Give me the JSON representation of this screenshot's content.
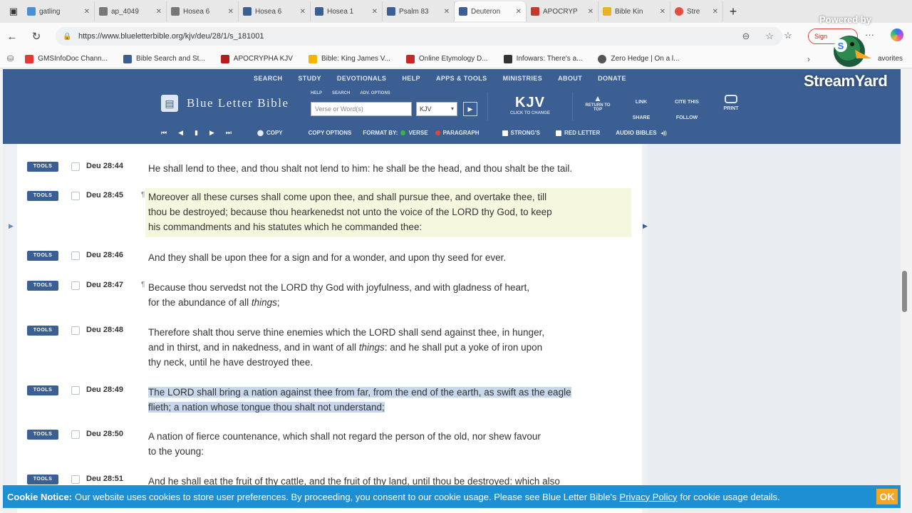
{
  "browser": {
    "tabs": [
      {
        "label": "gatling",
        "fav_color": "#4a90d9"
      },
      {
        "label": "ap_4049",
        "fav_color": "#777777"
      },
      {
        "label": "Hosea 6",
        "fav_color": "#777777"
      },
      {
        "label": "Hosea 6",
        "fav_color": "#3b5f92"
      },
      {
        "label": "Hosea 1",
        "fav_color": "#3b5f92"
      },
      {
        "label": "Psalm 83",
        "fav_color": "#3b5f92"
      },
      {
        "label": "Deuteron",
        "fav_color": "#3b5f92"
      },
      {
        "label": "APOCRYP",
        "fav_color": "#c0392b"
      },
      {
        "label": "Bible Kin",
        "fav_color": "#e6b422"
      },
      {
        "label": "Stre",
        "fav_color": "#e74c3c"
      }
    ],
    "url": "https://www.blueletterbible.org/kjv/deu/28/1/s_181001",
    "signin_label": "Sign",
    "bookmarks": [
      {
        "label": "GMSInfoDoc Chann...",
        "color": "#e53935"
      },
      {
        "label": "Bible Search and St...",
        "color": "#3b5f92"
      },
      {
        "label": "APOCRYPHA KJV",
        "color": "#b71c1c"
      },
      {
        "label": "Bible: King James V...",
        "color": "#f4b400"
      },
      {
        "label": "Online Etymology D...",
        "color": "#c62828"
      },
      {
        "label": "Infowars: There's a...",
        "color": "#333333"
      },
      {
        "label": "Zero Hedge | On a l...",
        "color": "#555555"
      }
    ],
    "favorites_label": "avorites"
  },
  "overlay": {
    "powered_by": "Powered by",
    "brand": "StreamYard"
  },
  "site": {
    "topnav": [
      "SEARCH",
      "STUDY",
      "DEVOTIONALS",
      "HELP",
      "APPS & TOOLS",
      "MINISTRIES",
      "ABOUT",
      "DONATE"
    ],
    "brand_name": "Blue Letter Bible",
    "small_links": [
      "HELP",
      "SEARCH",
      "ADV. OPTIONS"
    ],
    "search_placeholder": "Verse or Word(s)",
    "version": "KJV",
    "kjv_big": "KJV",
    "kjv_sub": "CLICK TO CHANGE",
    "return_top": "RETURN TO TOP",
    "link": "LINK",
    "share": "SHARE",
    "cite": "CITE THIS",
    "follow": "FOLLOW",
    "print": "PRINT",
    "copy": "COPY",
    "copy_options": "COPY OPTIONS",
    "format_by": "FORMAT BY:",
    "verse": "VERSE",
    "paragraph": "PARAGRAPH",
    "strongs": "STRONG'S",
    "red_letter": "RED LETTER",
    "audio": "AUDIO BIBLES"
  },
  "verses": [
    {
      "tools": "TOOLS",
      "ref": "Deu 28:44",
      "para": "",
      "lines": [
        "He shall lend to thee, and thou shalt not lend to him: he shall be the head, and thou shalt be the tail."
      ]
    },
    {
      "tools": "TOOLS",
      "ref": "Deu 28:45",
      "para": "¶",
      "lines": [
        "Moreover all these curses shall come upon thee, and shall pursue thee, and overtake thee, till",
        "thou be destroyed; because thou hearkenedst not unto the voice of the LORD thy God, to keep",
        "his commandments and his statutes which he commanded thee:"
      ]
    },
    {
      "tools": "TOOLS",
      "ref": "Deu 28:46",
      "para": "",
      "lines": [
        "And they shall be upon thee for a sign and for a wonder, and upon thy seed for ever."
      ]
    },
    {
      "tools": "TOOLS",
      "ref": "Deu 28:47",
      "para": "¶",
      "line1": "Because thou servedst not the LORD thy God with joyfulness, and with gladness of heart,",
      "line2_pre": "for the abundance of all ",
      "line2_ital": "things",
      "line2_post": ";"
    },
    {
      "tools": "TOOLS",
      "ref": "Deu 28:48",
      "para": "",
      "line1": "Therefore shalt thou serve thine enemies which the LORD shall send against thee, in hunger,",
      "line2_pre": "and in thirst, and in nakedness, and in want of all ",
      "line2_ital": "things",
      "line2_post": ": and he shall put a yoke of iron upon",
      "line3": "thy neck, until he have destroyed thee."
    },
    {
      "tools": "TOOLS",
      "ref": "Deu 28:49",
      "para": "",
      "lines": [
        "The LORD shall bring a nation against thee from far, from the end of the earth, as swift as the eagle",
        "flieth; a nation whose tongue thou shalt not understand;"
      ]
    },
    {
      "tools": "TOOLS",
      "ref": "Deu 28:50",
      "para": "",
      "lines": [
        "A nation of fierce countenance, which shall not regard the person of the old, nor shew favour",
        "to the young:"
      ]
    },
    {
      "tools": "TOOLS",
      "ref": "Deu 28:51",
      "para": "",
      "lines": [
        "And he shall eat the fruit of thy cattle, and the fruit of thy land, until thou be destroyed: which also"
      ]
    }
  ],
  "cookie": {
    "title": "Cookie Notice:",
    "text": "Our website uses cookies to store user preferences. By proceeding, you consent to our cookie usage. Please see Blue Letter Bible's",
    "link": "Privacy Policy",
    "tail": "for cookie usage details.",
    "ok": "OK"
  }
}
